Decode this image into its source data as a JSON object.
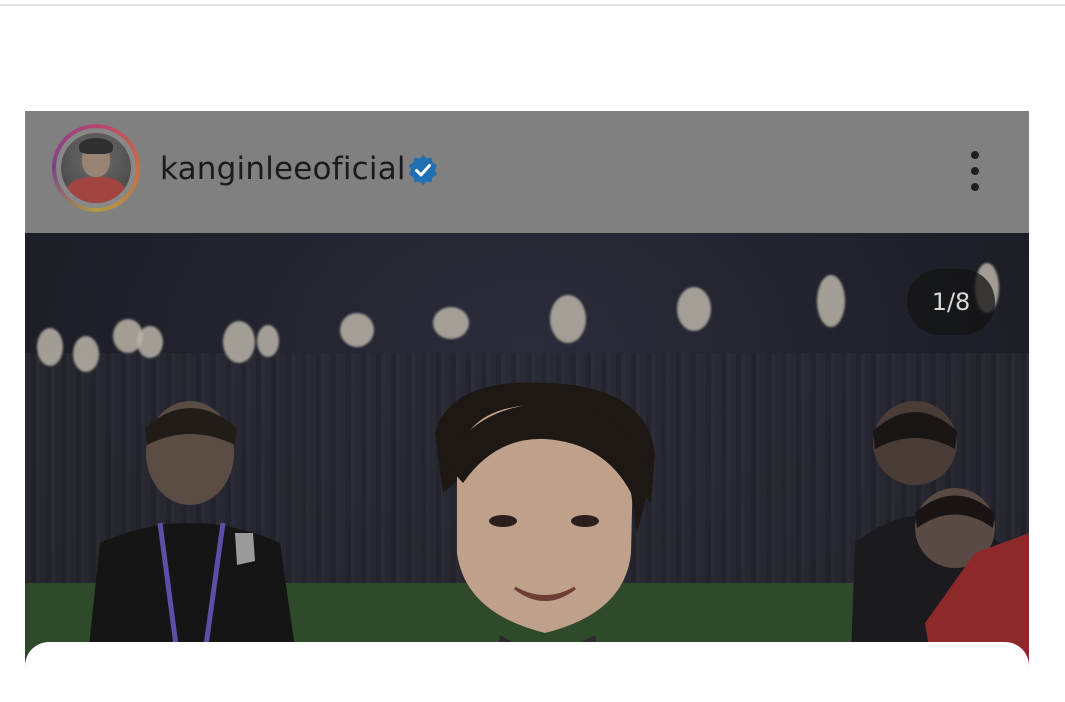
{
  "post": {
    "username": "kanginleeoficial",
    "verified": true,
    "counter": "1/8",
    "icons": {
      "verified": "verified-badge-icon",
      "more": "more-vertical-icon",
      "avatar": "profile-avatar"
    }
  },
  "colors": {
    "verified_badge": "#1f6fb3",
    "story_ring": "#c23a6f"
  }
}
